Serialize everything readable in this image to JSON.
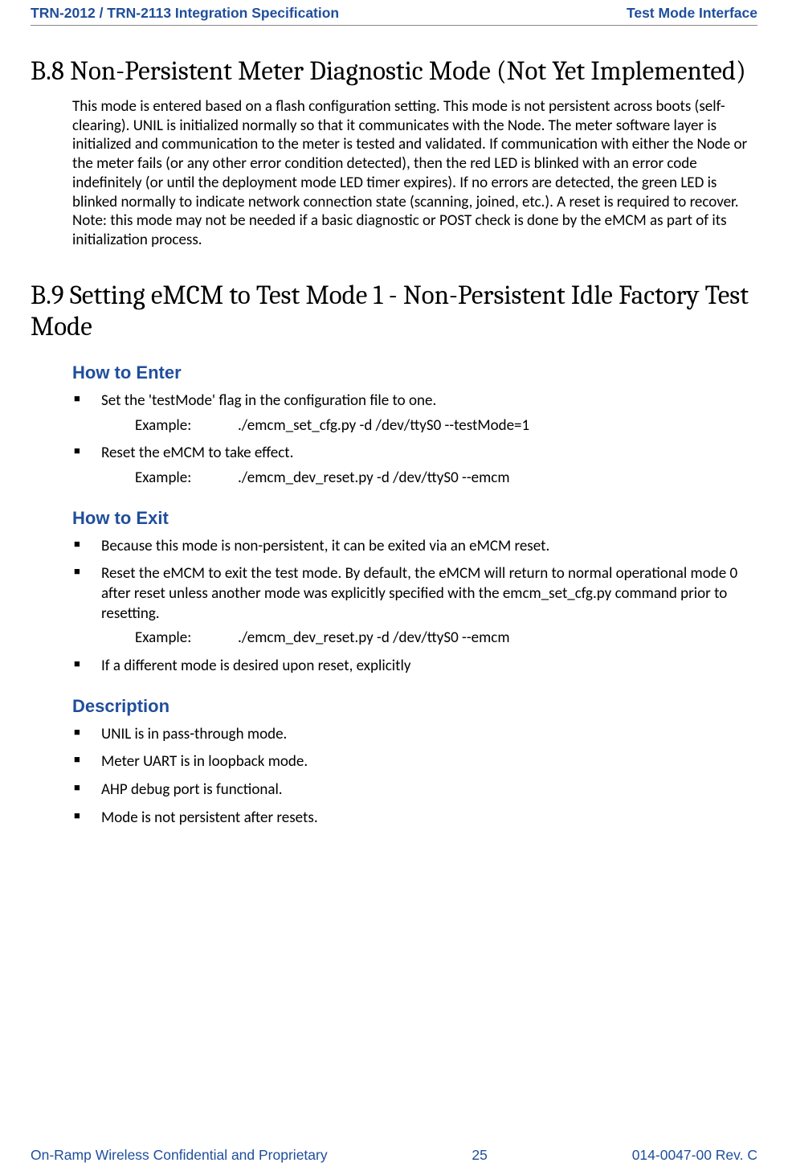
{
  "header": {
    "left": "TRN-2012 / TRN-2113 Integration Specification",
    "right": "Test Mode Interface"
  },
  "footer": {
    "left": "On-Ramp Wireless Confidential and Proprietary",
    "center": "25",
    "right": "014-0047-00 Rev. C"
  },
  "section_b8": {
    "title": "B.8 Non-Persistent Meter Diagnostic Mode (Not Yet Implemented)",
    "body": "This mode is entered based on a flash configuration setting. This mode is not persistent across boots (self-clearing). UNIL is initialized normally so that it communicates with the Node. The meter software layer is initialized and communication to the meter is tested and validated. If communication with either the Node or the meter fails (or any other error condition detected), then the red LED is blinked with an error code indefinitely (or until the deployment mode LED timer expires). If no errors are detected, the green LED is blinked normally to indicate network connection state (scanning, joined, etc.). A reset is required to recover. Note: this mode may not be needed if a basic diagnostic or POST check is done by the eMCM as part of its initialization process."
  },
  "section_b9": {
    "title": "B.9 Setting eMCM to Test Mode 1 - Non-Persistent Idle Factory Test Mode",
    "how_to_enter": {
      "heading": "How to Enter",
      "items": [
        {
          "text": "Set the 'testMode' flag in the configuration file to one.",
          "example_label": "Example:",
          "example_cmd": "./emcm_set_cfg.py -d /dev/ttyS0 --testMode=1"
        },
        {
          "text": "Reset the eMCM to take effect.",
          "example_label": "Example:",
          "example_cmd": "./emcm_dev_reset.py -d /dev/ttyS0 --emcm"
        }
      ]
    },
    "how_to_exit": {
      "heading": "How to Exit",
      "items": [
        {
          "text": "Because this mode is non-persistent, it can be exited via an eMCM reset."
        },
        {
          "text": "Reset the eMCM to exit the test mode. By default, the eMCM will return to normal operational mode 0 after reset unless another mode was explicitly specified with the emcm_set_cfg.py command prior to resetting.",
          "example_label": "Example:",
          "example_cmd": "./emcm_dev_reset.py -d /dev/ttyS0 --emcm"
        },
        {
          "text": "If a different mode is desired upon reset, explicitly"
        }
      ]
    },
    "description": {
      "heading": "Description",
      "items": [
        "UNIL is in pass-through mode.",
        "Meter UART is in loopback mode.",
        "AHP debug port is functional.",
        "Mode is not persistent after resets."
      ]
    }
  }
}
